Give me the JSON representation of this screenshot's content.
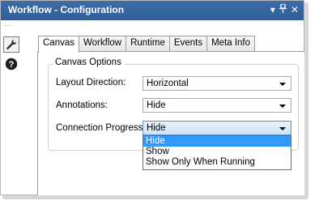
{
  "window": {
    "title": "Workflow - Configuration",
    "controls": [
      "▾",
      "⊣",
      "✕"
    ]
  },
  "toolstrip": {
    "grip": "⋯",
    "buttons": [
      {
        "icon": "wrench-icon",
        "glyph": "🔧"
      },
      {
        "icon": "help-icon",
        "glyph": "?"
      }
    ]
  },
  "tabs": [
    {
      "label": "Canvas",
      "active": true
    },
    {
      "label": "Workflow",
      "active": false
    },
    {
      "label": "Runtime",
      "active": false
    },
    {
      "label": "Events",
      "active": false
    },
    {
      "label": "Meta Info",
      "active": false
    }
  ],
  "canvas_options": {
    "group_title": "Canvas Options",
    "fields": [
      {
        "label": "Layout Direction:",
        "value": "Horizontal"
      },
      {
        "label": "Annotations:",
        "value": "Hide"
      },
      {
        "label": "Connection Progress:",
        "value": "Hide"
      }
    ],
    "dropdown_options": [
      "Hide",
      "Show",
      "Show Only When Running"
    ],
    "dropdown_selected": "Hide"
  },
  "colors": {
    "titlebar": "#2f5d96",
    "selection": "#3399ff"
  }
}
